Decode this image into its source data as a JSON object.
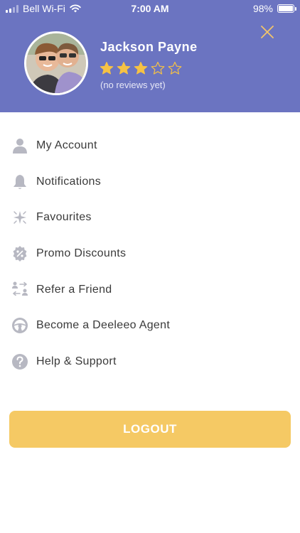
{
  "status_bar": {
    "carrier": "Bell Wi-Fi",
    "time": "7:00 AM",
    "battery": "98%",
    "battery_level": 0.98
  },
  "profile": {
    "name": "Jackson Payne",
    "rating": 3,
    "rating_max": 5,
    "reviews_note": "(no reviews yet)"
  },
  "colors": {
    "header_bg": "#6b74c1",
    "star_filled": "#f6c244",
    "star_empty": "#f6c244",
    "close_icon": "#f2c46a",
    "icon_gray": "#b7b8c2",
    "logout_bg": "#f5c964"
  },
  "menu": {
    "items": [
      {
        "label": "My Account",
        "icon": "person-icon"
      },
      {
        "label": "Notifications",
        "icon": "bell-icon"
      },
      {
        "label": "Favourites",
        "icon": "sparkle-icon"
      },
      {
        "label": "Promo Discounts",
        "icon": "percent-badge-icon"
      },
      {
        "label": "Refer a Friend",
        "icon": "refer-exchange-icon"
      },
      {
        "label": "Become a Deeleeo Agent",
        "icon": "steering-wheel-icon"
      },
      {
        "label": "Help & Support",
        "icon": "question-circle-icon"
      }
    ]
  },
  "logout": {
    "label": "LOGOUT"
  }
}
